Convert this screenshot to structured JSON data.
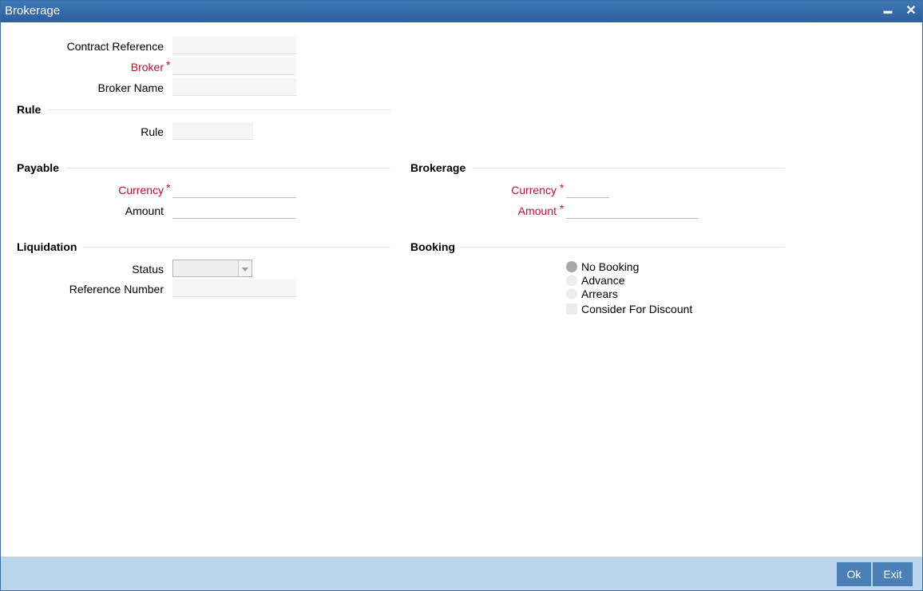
{
  "window": {
    "title": "Brokerage",
    "minimize_label": "▬",
    "close_label": "✕"
  },
  "header_fields": {
    "contract_reference": {
      "label": "Contract Reference",
      "value": ""
    },
    "broker": {
      "label": "Broker",
      "required_mark": "*",
      "value": ""
    },
    "broker_name": {
      "label": "Broker Name",
      "value": ""
    }
  },
  "rule_section": {
    "title": "Rule",
    "rule": {
      "label": "Rule",
      "value": ""
    }
  },
  "payable_section": {
    "title": "Payable",
    "currency": {
      "label": "Currency",
      "required_mark": "*",
      "value": ""
    },
    "amount": {
      "label": "Amount",
      "value": ""
    }
  },
  "brokerage_section": {
    "title": "Brokerage",
    "currency": {
      "label": "Currency",
      "required_mark": "*",
      "value": ""
    },
    "amount": {
      "label": "Amount",
      "required_mark": "*",
      "value": ""
    }
  },
  "liquidation_section": {
    "title": "Liquidation",
    "status": {
      "label": "Status",
      "selected": ""
    },
    "reference_number": {
      "label": "Reference Number",
      "value": ""
    }
  },
  "booking_section": {
    "title": "Booking",
    "options": [
      {
        "label": "No Booking",
        "selected": true
      },
      {
        "label": "Advance",
        "selected": false
      },
      {
        "label": "Arrears",
        "selected": false
      }
    ],
    "consider_for_discount": {
      "label": "Consider For Discount",
      "checked": false
    }
  },
  "footer": {
    "ok_label": "Ok",
    "exit_label": "Exit"
  },
  "colors": {
    "title_bar": "#2f65a3",
    "required": "#c0102a",
    "footer": "#bad5ec",
    "button": "#4a80b5"
  }
}
